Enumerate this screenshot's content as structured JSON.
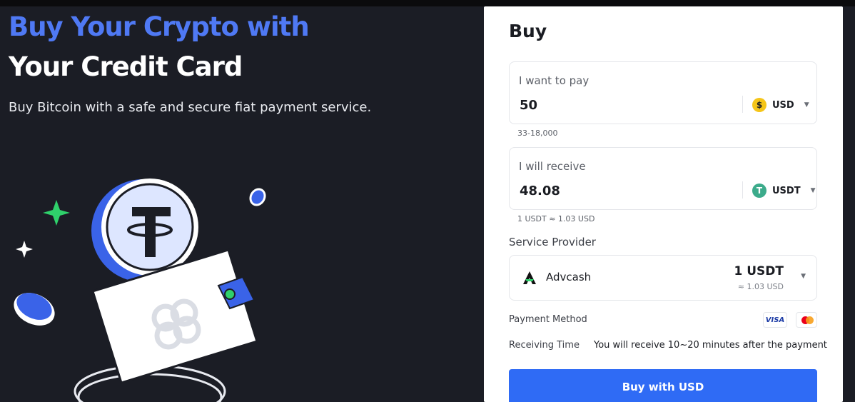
{
  "hero": {
    "title_line1": "Buy Your Crypto with",
    "title_line2": "Your Credit Card",
    "subtitle": "Buy Bitcoin with a safe and secure fiat payment service."
  },
  "card": {
    "title": "Buy",
    "pay": {
      "label": "I want to pay",
      "value": "50",
      "currency": "USD",
      "currency_icon": "$",
      "range_hint": "33-18,000"
    },
    "receive": {
      "label": "I will receive",
      "value": "48.08",
      "currency": "USDT",
      "currency_icon": "T",
      "rate_hint": "1 USDT ≈ 1.03 USD"
    },
    "provider": {
      "section_label": "Service Provider",
      "name": "Advcash",
      "amount": "1 USDT",
      "approx": "≈ 1.03 USD"
    },
    "payment_method_label": "Payment Method",
    "visa_label": "VISA",
    "receiving_time_label": "Receiving Time",
    "receiving_time_value": "You will receive 10~20 minutes after the payment",
    "buy_button": "Buy with USD"
  },
  "colors": {
    "accent": "#2f6bf5",
    "hero_blue": "#4f79f4",
    "background": "#1b1d25"
  }
}
